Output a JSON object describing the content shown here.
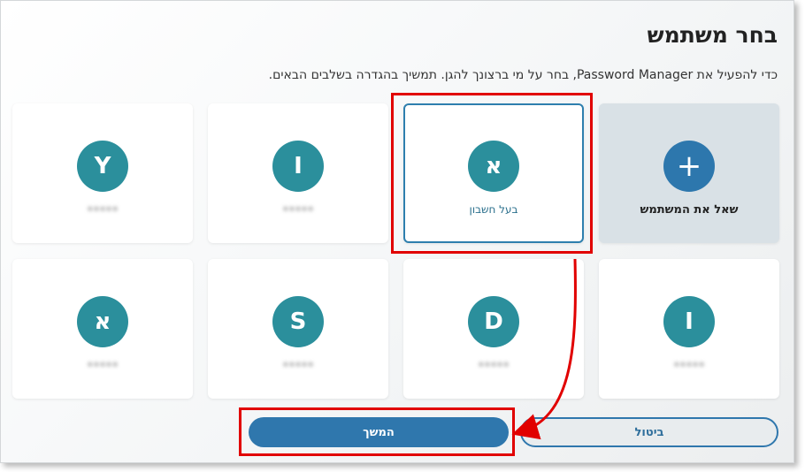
{
  "dialog": {
    "title": "בחר משתמש",
    "subtitle": "כדי להפעיל את Password Manager, בחר על מי ברצונך להגן. תמשיך בהגדרה בשלבים הבאים."
  },
  "cards": [
    {
      "initial": "+",
      "label": "שאל את המשתמש"
    },
    {
      "initial": "א",
      "label": "בעל חשבון",
      "selected": true
    },
    {
      "initial": "I",
      "label": "•••••"
    },
    {
      "initial": "Y",
      "label": "•••••"
    },
    {
      "initial": "I",
      "label": "•••••"
    },
    {
      "initial": "D",
      "label": "•••••"
    },
    {
      "initial": "S",
      "label": "•••••"
    },
    {
      "initial": "א",
      "label": "•••••"
    }
  ],
  "buttons": {
    "cancel": "ביטול",
    "continue": "המשך"
  },
  "colors": {
    "avatar": "#2b8f9c",
    "accent": "#2f77ad",
    "highlight": "#e10000"
  }
}
